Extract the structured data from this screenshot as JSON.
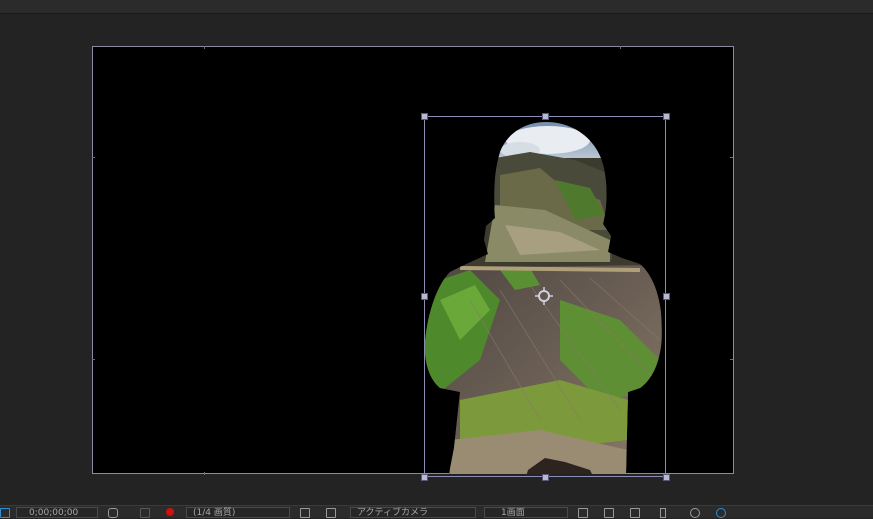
{
  "viewer": {
    "background": "#232323",
    "composition_color": "#000000",
    "frame_color": "#8a8aa0",
    "handle_color": "#b9b9d6",
    "layer": {
      "type": "masked-image-layer",
      "mask_shape": "hooded-person-silhouette",
      "content": "mountain-landscape-photo",
      "selected": true
    }
  },
  "bottom_bar": {
    "timecode": "0;00;00;00",
    "resolution": "(1/4 画質)",
    "camera": "アクティブカメラ",
    "views": "1画面",
    "record_color": "#d01010",
    "accent_color": "#2e8fd6"
  }
}
